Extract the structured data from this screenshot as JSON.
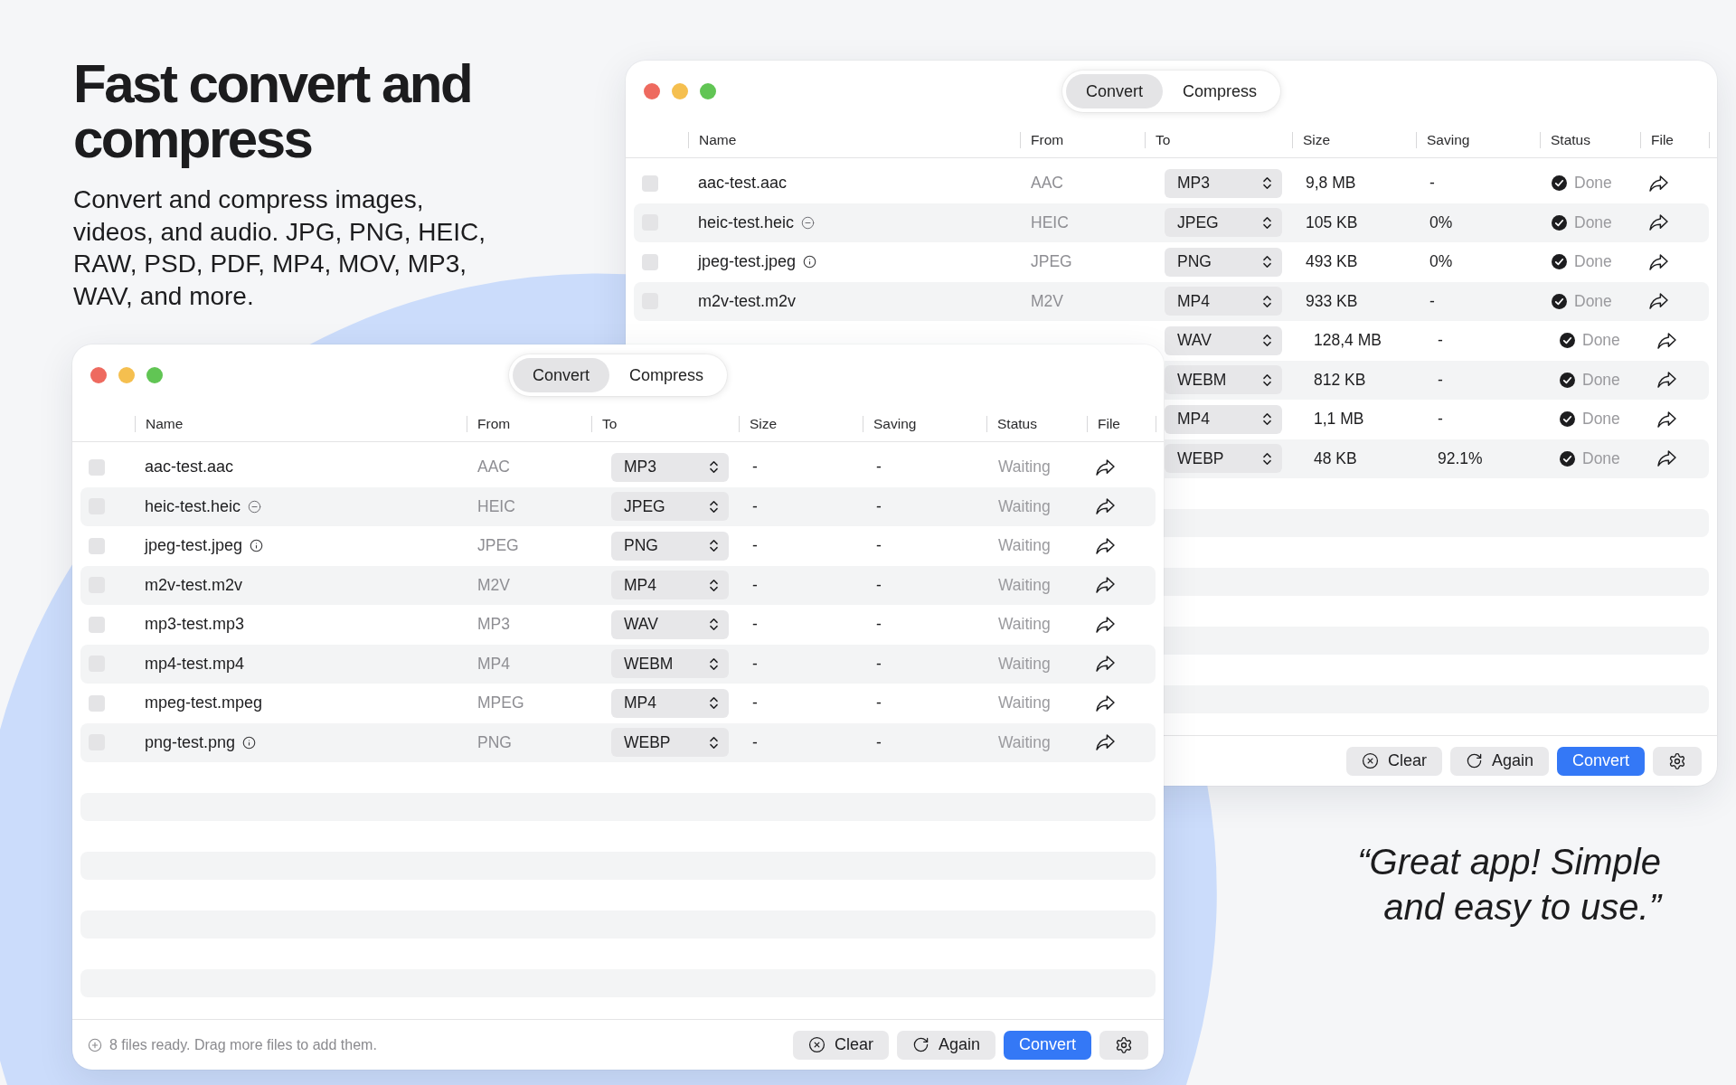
{
  "hero": {
    "title": "Fast convert and compress",
    "description": "Convert and compress images, videos, and audio. JPG, PNG, HEIC, RAW, PSD, PDF, MP4, MOV, MP3, WAV, and more."
  },
  "windows": [
    {
      "tabs": [
        {
          "label": "Convert",
          "selected": true
        },
        {
          "label": "Compress",
          "selected": false
        }
      ],
      "columns": [
        "Name",
        "From",
        "To",
        "Size",
        "Saving",
        "Status",
        "File"
      ],
      "rows": [
        {
          "checked": false,
          "name": "aac-test.aac",
          "from": "AAC",
          "to": "MP3",
          "size": "9,8 MB",
          "saving": "-",
          "status": {
            "kind": "done",
            "label": "Done"
          }
        },
        {
          "checked": false,
          "name": "heic-test.heic",
          "badge": {
            "kind": "minus"
          },
          "from": "HEIC",
          "to": "JPEG",
          "size": "105 KB",
          "saving": "0%",
          "status": {
            "kind": "done",
            "label": "Done"
          }
        },
        {
          "checked": false,
          "name": "jpeg-test.jpeg",
          "badge": {
            "kind": "info"
          },
          "from": "JPEG",
          "to": "PNG",
          "size": "493 KB",
          "saving": "0%",
          "status": {
            "kind": "done",
            "label": "Done"
          }
        },
        {
          "checked": false,
          "name": "m2v-test.m2v",
          "from": "M2V",
          "to": "MP4",
          "size": "933 KB",
          "saving": "-",
          "status": {
            "kind": "done",
            "label": "Done"
          }
        },
        {
          "to": "WAV",
          "size": "128,4 MB",
          "saving": "-",
          "status": {
            "kind": "done",
            "label": "Done"
          }
        },
        {
          "to": "WEBM",
          "size": "812 KB",
          "saving": "-",
          "status": {
            "kind": "done",
            "label": "Done"
          }
        },
        {
          "to": "MP4",
          "size": "1,1 MB",
          "saving": "-",
          "status": {
            "kind": "done",
            "label": "Done"
          }
        },
        {
          "to": "WEBP",
          "size": "48 KB",
          "saving": "92.1%",
          "status": {
            "kind": "done",
            "label": "Done"
          }
        }
      ],
      "footer": {
        "buttons": [
          {
            "kind": "clear",
            "label": "Clear"
          },
          {
            "kind": "again",
            "label": "Again"
          },
          {
            "kind": "convert",
            "label": "Convert"
          },
          {
            "kind": "settings"
          }
        ]
      }
    },
    {
      "tabs": [
        {
          "label": "Convert",
          "selected": true
        },
        {
          "label": "Compress",
          "selected": false
        }
      ],
      "columns": [
        "Name",
        "From",
        "To",
        "Size",
        "Saving",
        "Status",
        "File"
      ],
      "rows": [
        {
          "checked": false,
          "name": "aac-test.aac",
          "from": "AAC",
          "to": "MP3",
          "size": "-",
          "saving": "-",
          "status": {
            "kind": "waiting",
            "label": "Waiting"
          }
        },
        {
          "checked": false,
          "name": "heic-test.heic",
          "badge": {
            "kind": "minus"
          },
          "from": "HEIC",
          "to": "JPEG",
          "size": "-",
          "saving": "-",
          "status": {
            "kind": "waiting",
            "label": "Waiting"
          }
        },
        {
          "checked": false,
          "name": "jpeg-test.jpeg",
          "badge": {
            "kind": "info"
          },
          "from": "JPEG",
          "to": "PNG",
          "size": "-",
          "saving": "-",
          "status": {
            "kind": "waiting",
            "label": "Waiting"
          }
        },
        {
          "checked": false,
          "name": "m2v-test.m2v",
          "from": "M2V",
          "to": "MP4",
          "size": "-",
          "saving": "-",
          "status": {
            "kind": "waiting",
            "label": "Waiting"
          }
        },
        {
          "checked": false,
          "name": "mp3-test.mp3",
          "from": "MP3",
          "to": "WAV",
          "size": "-",
          "saving": "-",
          "status": {
            "kind": "waiting",
            "label": "Waiting"
          }
        },
        {
          "checked": false,
          "name": "mp4-test.mp4",
          "from": "MP4",
          "to": "WEBM",
          "size": "-",
          "saving": "-",
          "status": {
            "kind": "waiting",
            "label": "Waiting"
          }
        },
        {
          "checked": false,
          "name": "mpeg-test.mpeg",
          "from": "MPEG",
          "to": "MP4",
          "size": "-",
          "saving": "-",
          "status": {
            "kind": "waiting",
            "label": "Waiting"
          }
        },
        {
          "checked": false,
          "name": "png-test.png",
          "badge": {
            "kind": "info"
          },
          "from": "PNG",
          "to": "WEBP",
          "size": "-",
          "saving": "-",
          "status": {
            "kind": "waiting",
            "label": "Waiting"
          }
        }
      ],
      "footer": {
        "status": "8 files ready. Drag more files to add them.",
        "buttons": [
          {
            "kind": "clear",
            "label": "Clear"
          },
          {
            "kind": "again",
            "label": "Again"
          },
          {
            "kind": "convert",
            "label": "Convert"
          },
          {
            "kind": "settings"
          }
        ]
      }
    }
  ],
  "quote": "“Great app! Simple and easy to use.”"
}
